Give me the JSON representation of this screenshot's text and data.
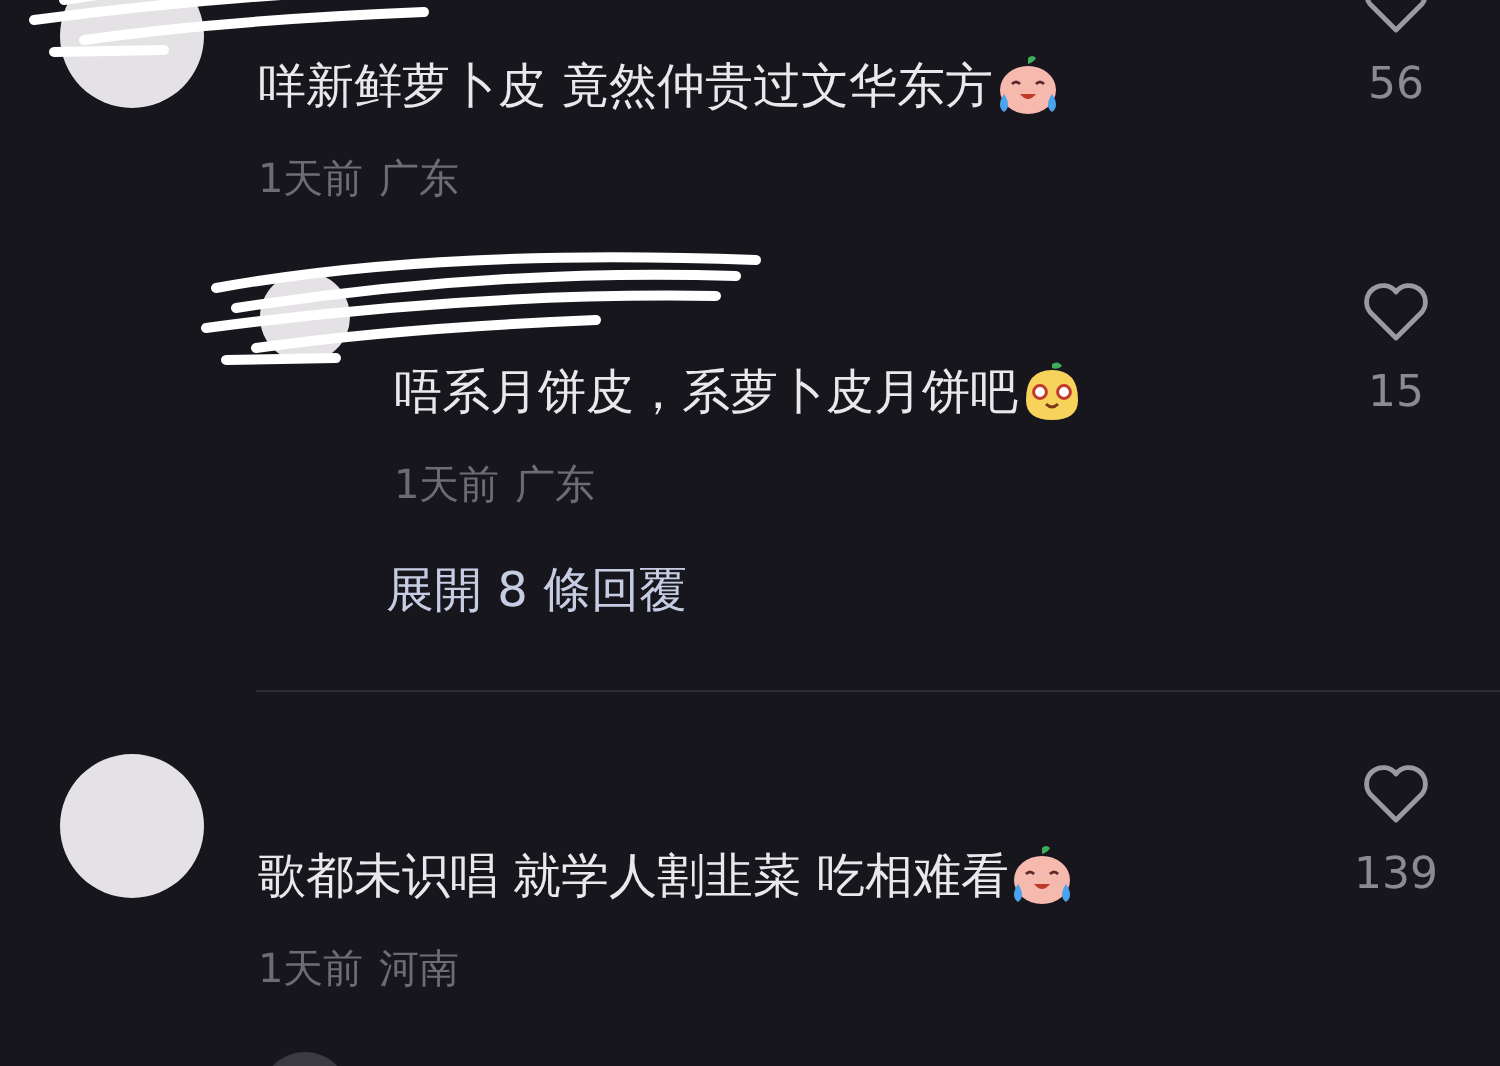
{
  "comments": [
    {
      "kind": "crying",
      "name_redacted": true,
      "text": "咩新鲜萝卜皮 竟然仲贵过文华东方",
      "time": "1天前",
      "location": "广东",
      "liked": false,
      "likes": "56",
      "replies": [
        {
          "kind": "grin",
          "name_redacted": true,
          "text": "唔系月饼皮，系萝卜皮月饼吧",
          "time": "1天前",
          "location": "广东",
          "liked": false,
          "likes": "15"
        }
      ],
      "expand_replies": "展開 8 條回覆"
    },
    {
      "kind": "crying",
      "text": "歌都未识唱 就学人割韭菜 吃相难看",
      "time": "1天前",
      "location": "河南",
      "liked": false,
      "likes": "139"
    }
  ]
}
